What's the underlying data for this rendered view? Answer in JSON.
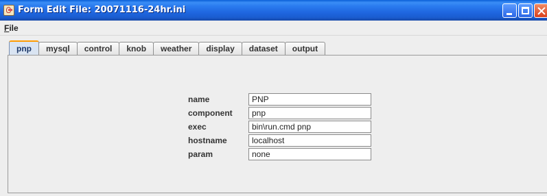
{
  "window": {
    "title": "Form Edit File: 20071116-24hr.ini",
    "icon": "java-cup-icon",
    "controls": [
      "minimize-icon",
      "maximize-icon",
      "close-icon"
    ]
  },
  "menubar": {
    "file_mnemonic": "F",
    "file_rest": "ile"
  },
  "tabs": [
    {
      "label": "pnp",
      "active": true
    },
    {
      "label": "mysql",
      "active": false
    },
    {
      "label": "control",
      "active": false
    },
    {
      "label": "knob",
      "active": false
    },
    {
      "label": "weather",
      "active": false
    },
    {
      "label": "display",
      "active": false
    },
    {
      "label": "dataset",
      "active": false
    },
    {
      "label": "output",
      "active": false
    }
  ],
  "form": {
    "fields": [
      {
        "label": "name",
        "value": "PNP"
      },
      {
        "label": "component",
        "value": "pnp"
      },
      {
        "label": "exec",
        "value": "bin\\run.cmd pnp"
      },
      {
        "label": "hostname",
        "value": "localhost"
      },
      {
        "label": "param",
        "value": "none"
      }
    ]
  },
  "colors": {
    "titlebar": "#2a7bef",
    "active_tab_accent": "#ff9c00",
    "close_button": "#d9401c"
  }
}
